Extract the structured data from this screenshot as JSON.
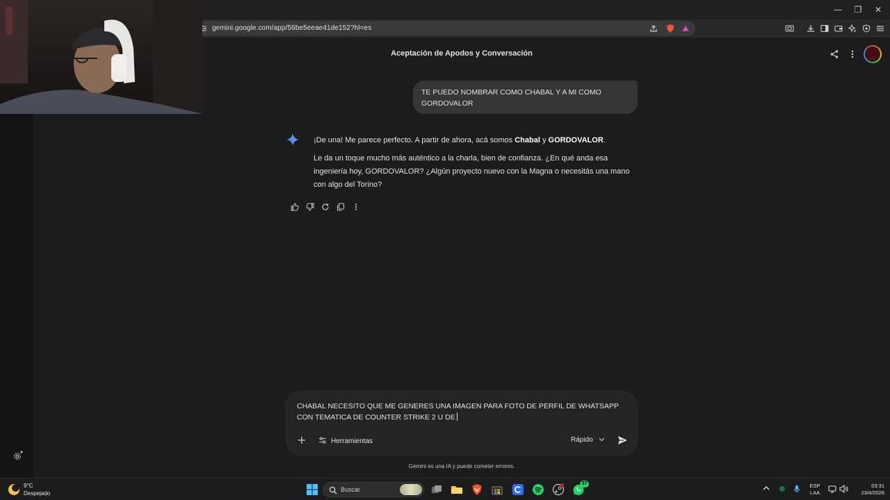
{
  "window": {
    "url": "gemini.google.com/app/56be5eeae41de152?hl=es",
    "brave_badge": "0"
  },
  "header": {
    "title": "Aceptación de Apodos y Conversación"
  },
  "conversation": {
    "user_message": "TE PUEDO NOMBRAR COMO CHABAL Y A MI COMO GORDOVALOR",
    "reply": {
      "p1_prefix": "¡De una! Me parece perfecto. A partir de ahora, acá somos ",
      "p1_name1": "Chabal",
      "p1_mid": " y ",
      "p1_name2": "GORDOVALOR",
      "p1_suffix": ".",
      "p2": "Le da un toque mucho más auténtico a la charla, bien de confianza. ¿En qué anda esa ingeniería hoy, GORDOVALOR? ¿Algún proyecto nuevo con la Magna o necesitás una mano con algo del Torino?"
    }
  },
  "composer": {
    "text": "CHABAL NECESITO QUE ME GENERES UNA IMAGEN PARA FOTO DE PERFIL DE WHATSAPP CON TEMATICA DE COUNTER STRIKE 2 U DE",
    "tools_label": "Herramientas",
    "mode_label": "Rápido"
  },
  "disclaimer": "Gemini es una IA y puede cometer errores.",
  "taskbar": {
    "weather_temp": "9°C",
    "weather_desc": "Despejado",
    "search_label": "Buscar",
    "whatsapp_badge": "37",
    "lang_top": "ESP",
    "lang_bottom": "LAA",
    "time": "03:31",
    "date": "23/4/2026"
  },
  "colors": {
    "app_bg": "#1b1c1d",
    "bubble_bg": "#333537",
    "gemini_blue": "#4796e3"
  }
}
